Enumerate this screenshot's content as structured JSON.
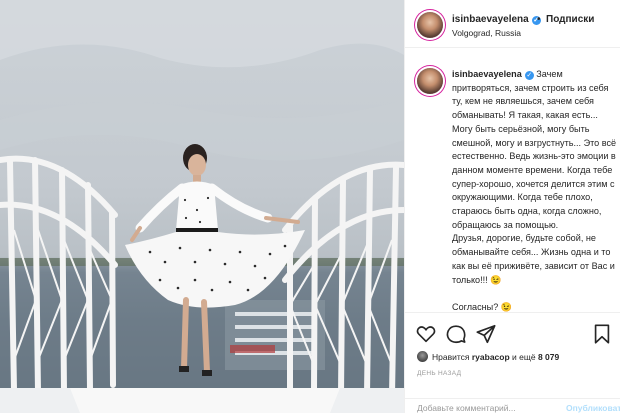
{
  "post": {
    "username": "isinbaevayelena",
    "verified_glyph": "✓",
    "follow_separator": "•",
    "follow_label": "Подписки",
    "location": "Volgograd, Russia",
    "caption_text": "Зачем притворяться, зачем строить из себя ту, кем не являешься, зачем себя обманывать! Я такая, какая есть... Могу быть серьёзной, могу быть смешной, могу и взгрустнуть... Это всё естественно. Ведь жизнь-это эмоции в данном моменте времени. Когда тебе супер-хорошо, хочется делится этим с окружающими. Когда тебе плохо, стараюсь быть одна, когда сложно, обращаюсь за помощью.\nДрузья, дорогие, будьте собой, не обманывайте себя... Жизнь одна и то как вы её приживёте, зависит от Вас и только!!! 😉\n\nСогласны? 😉",
    "likes_prefix": "Нравится ",
    "likes_user": "ryabacop",
    "likes_middle": " и ещё ",
    "likes_count": "8 079",
    "time_label": "ДЕНЬ НАЗАД"
  },
  "comment_box": {
    "placeholder": "Добавьте комментарий...",
    "publish_label": "Опубликовать"
  },
  "icons": {
    "like": "heart-icon",
    "comment": "comment-bubble-icon",
    "share": "share-icon",
    "save": "bookmark-icon"
  },
  "colors": {
    "link_blue": "#3897f0",
    "publish_disabled": "#b2dffc",
    "story_ring": "#d6249f",
    "muted_text": "#999999"
  }
}
